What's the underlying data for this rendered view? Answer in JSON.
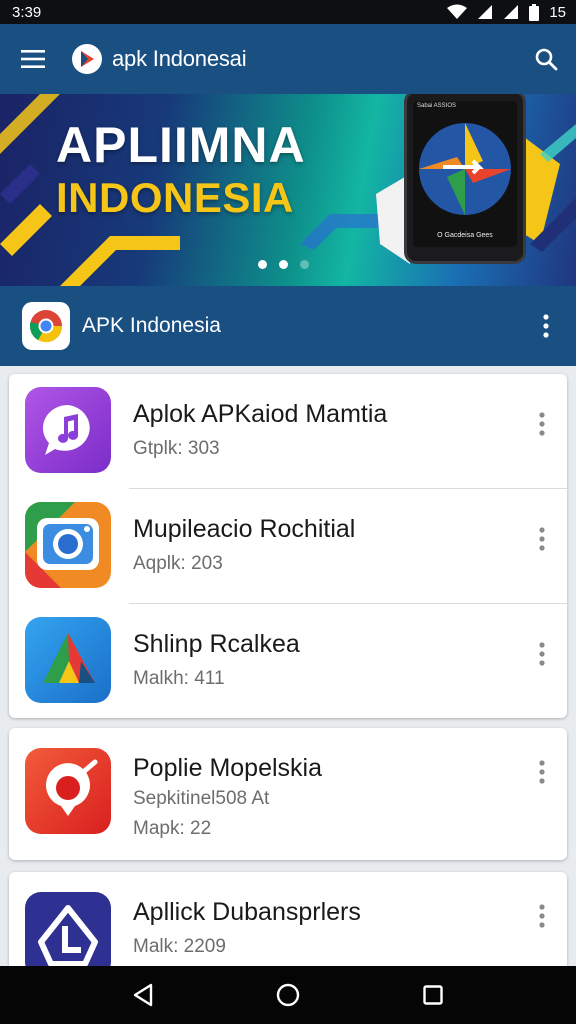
{
  "status_bar": {
    "time": "3:39",
    "battery_label": "15"
  },
  "app_bar": {
    "title": "apk Indonesai"
  },
  "banner": {
    "line1": "APLIIMNA",
    "line2": "INDONESIA",
    "phone_top_text": "Sabai ASSIOS",
    "phone_bottom_text": "O Gacdeisa Gees"
  },
  "section": {
    "title": "APK Indonesia"
  },
  "apps": [
    {
      "name": "Aplok APKaiod Mamtia",
      "meta": "Gtplk: 303",
      "icon": "music-chat-icon",
      "color": "#8a3fd8"
    },
    {
      "name": "Mupileacio Rochitial",
      "meta": "Aqplk: 203",
      "icon": "camera-icon",
      "color": "#f08a24"
    },
    {
      "name": "Shlinp Rcalkea",
      "meta": "Malkh: 411",
      "icon": "arrow-a-icon",
      "color": "#2196f3"
    },
    {
      "name": "Poplie Mopelskia",
      "meta": "Sepkitinel508 At",
      "meta2": "Mapk: 22",
      "icon": "target-pin-icon",
      "color": "#e53935"
    },
    {
      "name": "Apllick Dubansprlers",
      "meta": "Malk: 2209",
      "icon": "house-l-icon",
      "color": "#2e3192"
    }
  ]
}
